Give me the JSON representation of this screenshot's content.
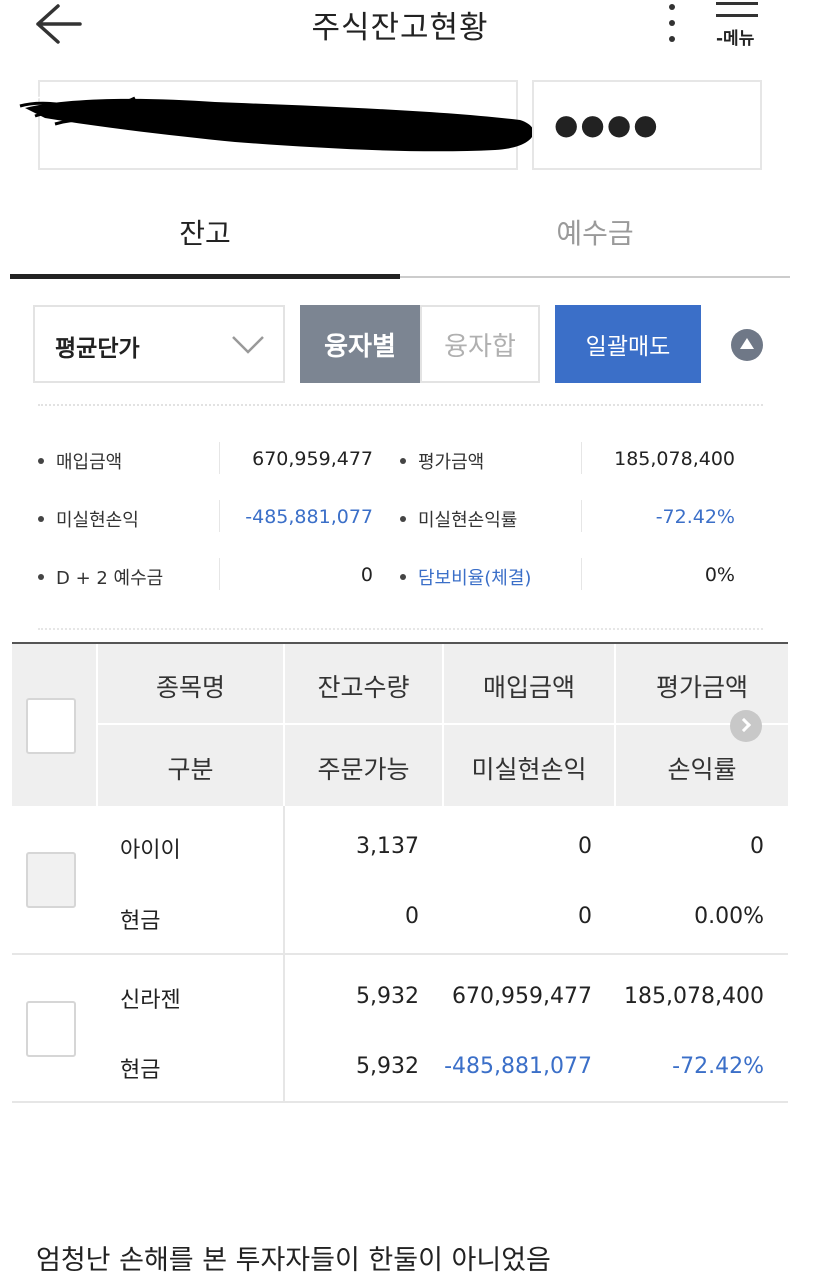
{
  "header": {
    "title": "주식잔고현황",
    "menu_label": "-메뉴"
  },
  "account": {
    "password_mask": "●●●●"
  },
  "tabs": [
    {
      "label": "잔고",
      "active": true
    },
    {
      "label": "예수금",
      "active": false
    }
  ],
  "controls": {
    "select_value": "평균단가",
    "seg_by_loan": "융자별",
    "seg_loan_sum": "융자합",
    "bulk_sell": "일괄매도"
  },
  "summary": {
    "purchase_amount_label": "매입금액",
    "purchase_amount": "670,959,477",
    "eval_amount_label": "평가금액",
    "eval_amount": "185,078,400",
    "unrealized_pl_label": "미실현손익",
    "unrealized_pl": "-485,881,077",
    "unrealized_rate_label": "미실현손익률",
    "unrealized_rate": "-72.42%",
    "d2_deposit_label": "D + 2 예수금",
    "d2_deposit": "0",
    "collateral_ratio_label": "담보비율(체결)",
    "collateral_ratio": "0%"
  },
  "table": {
    "headers_top": [
      "종목명",
      "잔고수량",
      "매입금액",
      "평가금액"
    ],
    "headers_bottom": [
      "구분",
      "주문가능",
      "미실현손익",
      "손익률"
    ],
    "rows": [
      {
        "name": "아이이",
        "qty": "3,137",
        "purchase": "0",
        "eval": "0",
        "type": "현금",
        "orderable": "0",
        "pl": "0",
        "rate": "0.00%"
      },
      {
        "name": "신라젠",
        "qty": "5,932",
        "purchase": "670,959,477",
        "eval": "185,078,400",
        "type": "현금",
        "orderable": "5,932",
        "pl": "-485,881,077",
        "rate": "-72.42%"
      }
    ]
  },
  "colors": {
    "accent": "#3b6fc8",
    "segment_active": "#7c8592",
    "negative": "#3b6fc8"
  },
  "caption": "엄청난 손해를 본 투자자들이 한둘이 아니었음"
}
